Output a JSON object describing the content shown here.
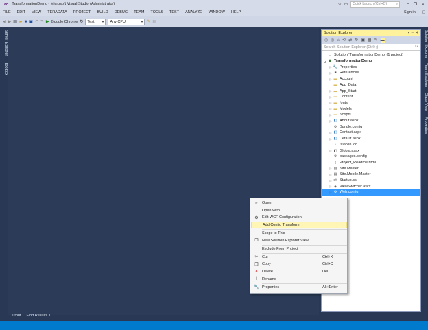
{
  "window": {
    "title": "TransformationDemo - Microsoft Visual Studio (Administrator)",
    "quick_launch_placeholder": "Quick Launch (Ctrl+Q)",
    "sign_in": "Sign in"
  },
  "menu": [
    "FILE",
    "EDIT",
    "VIEW",
    "TERADATA",
    "PROJECT",
    "BUILD",
    "DEBUG",
    "TEAM",
    "TOOLS",
    "TEST",
    "ANALYZE",
    "WINDOW",
    "HELP"
  ],
  "toolbar": {
    "browser": "Google Chrome",
    "config": "Test",
    "platform": "Any CPU"
  },
  "left_tabs": [
    "Server Explorer",
    "Toolbox"
  ],
  "right_tabs": [
    "Solution Explorer",
    "Team Explorer",
    "Class View",
    "Properties"
  ],
  "solution_explorer": {
    "title": "Solution Explorer",
    "search_placeholder": "Search Solution Explorer (Ctrl+;)",
    "items": [
      {
        "label": "Solution 'TransformationDemo' (1 project)",
        "icon": "solution-icon",
        "level": 0,
        "exp": ""
      },
      {
        "label": "TransformationDemo",
        "icon": "project-icon",
        "level": 0,
        "exp": "◢",
        "bold": true
      },
      {
        "label": "Properties",
        "icon": "wrench-icon",
        "level": 1,
        "exp": "▷"
      },
      {
        "label": "References",
        "icon": "references-icon",
        "level": 1,
        "exp": "▷"
      },
      {
        "label": "Account",
        "icon": "folder-icon",
        "level": 1,
        "exp": "▷"
      },
      {
        "label": "App_Data",
        "icon": "folder-icon",
        "level": 1,
        "exp": ""
      },
      {
        "label": "App_Start",
        "icon": "folder-icon",
        "level": 1,
        "exp": "▷"
      },
      {
        "label": "Content",
        "icon": "folder-icon",
        "level": 1,
        "exp": "▷"
      },
      {
        "label": "fonts",
        "icon": "folder-icon",
        "level": 1,
        "exp": "▷"
      },
      {
        "label": "Models",
        "icon": "folder-icon",
        "level": 1,
        "exp": "▷"
      },
      {
        "label": "Scripts",
        "icon": "folder-icon",
        "level": 1,
        "exp": "▷"
      },
      {
        "label": "About.aspx",
        "icon": "aspx-icon",
        "level": 1,
        "exp": "▷"
      },
      {
        "label": "Bundle.config",
        "icon": "config-icon",
        "level": 1,
        "exp": ""
      },
      {
        "label": "Contact.aspx",
        "icon": "aspx-icon",
        "level": 1,
        "exp": "▷"
      },
      {
        "label": "Default.aspx",
        "icon": "aspx-icon",
        "level": 1,
        "exp": "▷"
      },
      {
        "label": "favicon.ico",
        "icon": "image-icon",
        "level": 1,
        "exp": ""
      },
      {
        "label": "Global.asax",
        "icon": "asax-icon",
        "level": 1,
        "exp": "▷"
      },
      {
        "label": "packages.config",
        "icon": "config-icon",
        "level": 1,
        "exp": ""
      },
      {
        "label": "Project_Readme.html",
        "icon": "html-icon",
        "level": 1,
        "exp": ""
      },
      {
        "label": "Site.Master",
        "icon": "master-icon",
        "level": 1,
        "exp": "▷"
      },
      {
        "label": "Site.Mobile.Master",
        "icon": "master-icon",
        "level": 1,
        "exp": "▷"
      },
      {
        "label": "Startup.cs",
        "icon": "csharp-icon",
        "level": 1,
        "exp": "▷"
      },
      {
        "label": "ViewSwitcher.ascx",
        "icon": "ascx-icon",
        "level": 1,
        "exp": "▷"
      },
      {
        "label": "Web.config",
        "icon": "config-icon",
        "level": 1,
        "exp": "▷",
        "selected": true
      }
    ]
  },
  "context_menu": [
    {
      "label": "Open",
      "icon": "open-icon",
      "shortcut": ""
    },
    {
      "label": "Open With...",
      "icon": "",
      "shortcut": ""
    },
    {
      "label": "Edit WCF Configuration",
      "icon": "wcf-icon",
      "shortcut": ""
    },
    {
      "label": "Add Config Transform",
      "icon": "",
      "shortcut": "",
      "highlighted": true,
      "sep_after": true
    },
    {
      "label": "Scope to This",
      "icon": "",
      "shortcut": ""
    },
    {
      "label": "New Solution Explorer View",
      "icon": "new-view-icon",
      "shortcut": "",
      "sep_after": true
    },
    {
      "label": "Exclude From Project",
      "icon": "",
      "shortcut": "",
      "sep_after": true
    },
    {
      "label": "Cut",
      "icon": "cut-icon",
      "shortcut": "Ctrl+X"
    },
    {
      "label": "Copy",
      "icon": "copy-icon",
      "shortcut": "Ctrl+C"
    },
    {
      "label": "Delete",
      "icon": "delete-icon",
      "shortcut": "Del"
    },
    {
      "label": "Rename",
      "icon": "rename-icon",
      "shortcut": "",
      "sep_after": true
    },
    {
      "label": "Properties",
      "icon": "wrench-icon",
      "shortcut": "Alt+Enter"
    }
  ],
  "bottom_tabs": [
    "Output",
    "Find Results 1"
  ]
}
